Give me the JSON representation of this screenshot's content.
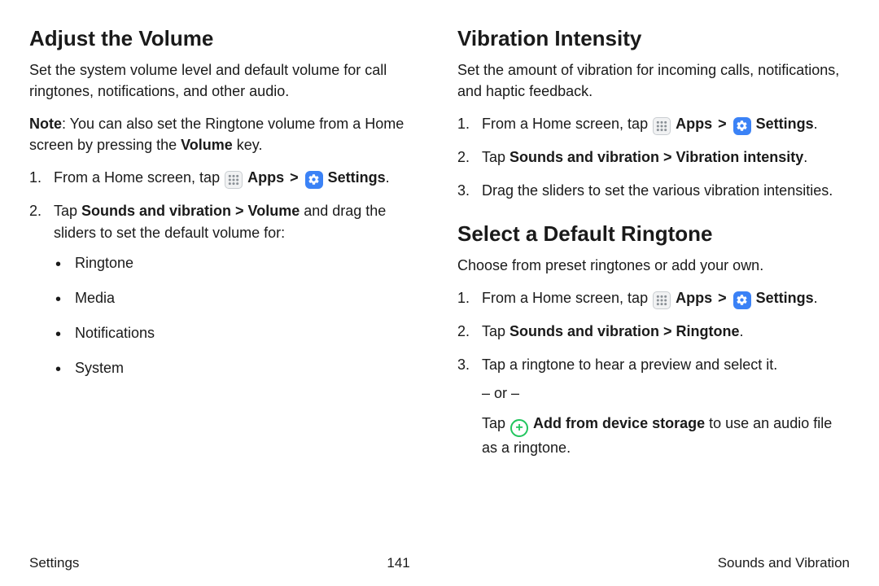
{
  "left": {
    "heading": "Adjust the Volume",
    "intro": "Set the system volume level and default volume for call ringtones, notifications, and other audio.",
    "note_label": "Note",
    "note_text": ": You can also set the Ringtone volume from a Home screen by pressing the ",
    "note_bold": "Volume",
    "note_tail": " key.",
    "step1_a": "From a Home screen, tap ",
    "apps_label": "Apps",
    "chevron": ">",
    "settings_label": "Settings",
    "period": ".",
    "step2_a": "Tap ",
    "step2_b": "Sounds and vibration > Volume",
    "step2_c": " and drag the sliders to set the default volume for:",
    "bullets": [
      "Ringtone",
      "Media",
      "Notifications",
      "System"
    ]
  },
  "right_a": {
    "heading": "Vibration Intensity",
    "intro": "Set the amount of vibration for incoming calls, notifications, and haptic feedback.",
    "step1_a": "From a Home screen, tap ",
    "step2_a": "Tap ",
    "step2_b": "Sounds and vibration > Vibration intensity",
    "step3": "Drag the sliders to set the various vibration intensities."
  },
  "right_b": {
    "heading": "Select a Default Ringtone",
    "intro": "Choose from preset ringtones or add your own.",
    "step1_a": "From a Home screen, tap ",
    "step2_a": "Tap ",
    "step2_b": "Sounds and vibration > Ringtone",
    "step3": "Tap a ringtone to hear a preview and select it.",
    "or": "– or –",
    "step3b_a": "Tap ",
    "step3b_b": "Add from device storage",
    "step3b_c": " to use an audio file as a ringtone."
  },
  "shared": {
    "apps_label": "Apps",
    "settings_label": "Settings",
    "chevron": ">",
    "period": "."
  },
  "footer": {
    "left": "Settings",
    "center": "141",
    "right": "Sounds and Vibration"
  }
}
